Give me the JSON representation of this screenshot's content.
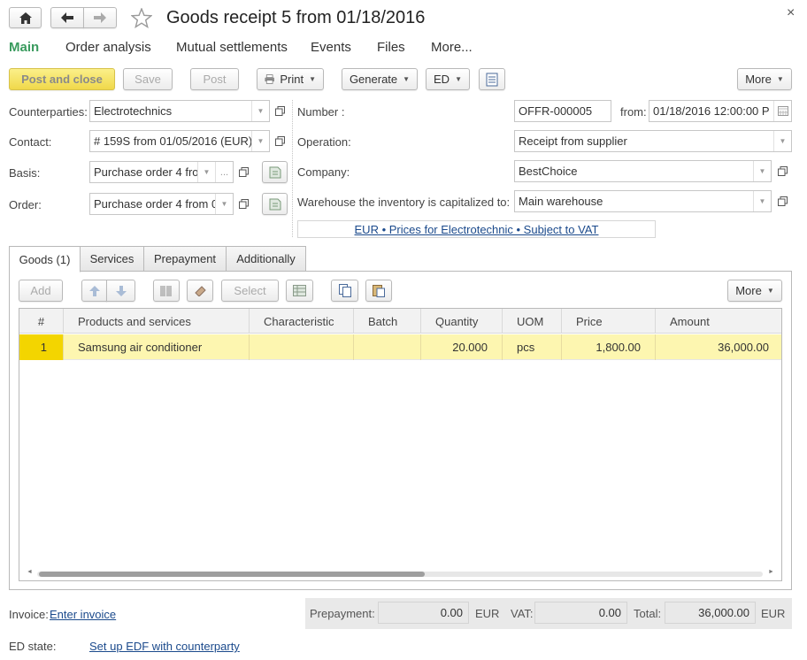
{
  "window": {
    "title": "Goods receipt 5 from 01/18/2016",
    "close_glyph": "×"
  },
  "section_tabs": [
    "Main",
    "Order analysis",
    "Mutual settlements",
    "Events",
    "Files",
    "More..."
  ],
  "colors": {
    "accent_green": "#3a9b5e",
    "primary_button": "#f4e05a",
    "selected_row": "#fdf6b0",
    "row_number_cell": "#f3d500",
    "link": "#1b4a8c"
  },
  "toolbar": {
    "post_close": "Post and close",
    "save": "Save",
    "post": "Post",
    "print": "Print",
    "generate": "Generate",
    "ed": "ED",
    "more": "More"
  },
  "form": {
    "counterparties_label": "Counterparties:",
    "counterparties_value": "Electrotechnics",
    "contact_label": "Contact:",
    "contact_value": "# 159S from 01/05/2016 (EUR)",
    "basis_label": "Basis:",
    "basis_value": "Purchase order 4 fro",
    "basis_dots": "...",
    "order_label": "Order:",
    "order_value": "Purchase order 4 from 0",
    "number_label": "Number :",
    "number_value": "OFFR-000005",
    "from_label": "from:",
    "from_value": "01/18/2016 12:00:00 P",
    "operation_label": "Operation:",
    "operation_value": "Receipt from supplier",
    "company_label": "Company:",
    "company_value": "BestChoice",
    "warehouse_label": "Warehouse the inventory is capitalized to:",
    "warehouse_value": "Main warehouse",
    "price_link": "EUR • Prices for Electrotechnic • Subject to VAT"
  },
  "doc_tabs": [
    "Goods (1)",
    "Services",
    "Prepayment",
    "Additionally"
  ],
  "table_toolbar": {
    "add": "Add",
    "select": "Select",
    "more": "More"
  },
  "table": {
    "columns": [
      "#",
      "Products and services",
      "Characteristic",
      "Batch",
      "Quantity",
      "UOM",
      "Price",
      "Amount"
    ],
    "rows": [
      {
        "n": "1",
        "product": "Samsung air conditioner",
        "characteristic": "",
        "batch": "",
        "quantity": "20.000",
        "uom": "pcs",
        "price": "1,800.00",
        "amount": "36,000.00"
      }
    ]
  },
  "footer": {
    "invoice_label": "Invoice:",
    "invoice_link": "Enter invoice",
    "ed_state_label": "ED state:",
    "ed_state_link": "Set up EDF with counterparty",
    "prepayment_label": "Prepayment:",
    "prepayment_value": "0.00",
    "prepayment_currency": "EUR",
    "vat_label": "VAT:",
    "vat_value": "0.00",
    "total_label": "Total:",
    "total_value": "36,000.00",
    "total_currency": "EUR"
  }
}
